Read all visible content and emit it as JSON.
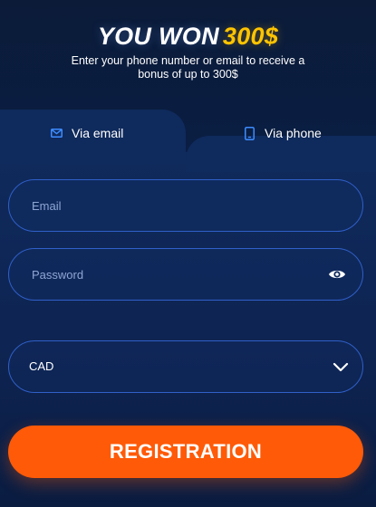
{
  "header": {
    "title_main": "YOU WON",
    "title_amount": "300$",
    "subtitle": "Enter your phone number or email to receive a bonus of up to 300$"
  },
  "tabs": [
    {
      "label": "Via email",
      "icon": "envelope-icon",
      "active": true
    },
    {
      "label": "Via phone",
      "icon": "phone-icon",
      "active": false
    }
  ],
  "form": {
    "email": {
      "placeholder": "Email",
      "value": ""
    },
    "password": {
      "placeholder": "Password",
      "value": "",
      "toggle_icon": "eye-icon"
    },
    "currency": {
      "selected": "CAD",
      "icon": "chevron-down-icon"
    },
    "submit_label": "REGISTRATION"
  },
  "colors": {
    "background": "#0f2552",
    "header": "#0b1b38",
    "accent_gold": "#ffc400",
    "button": "#ff5a07",
    "field_border": "#2f5fc8",
    "icon_blue": "#3d8cff"
  }
}
